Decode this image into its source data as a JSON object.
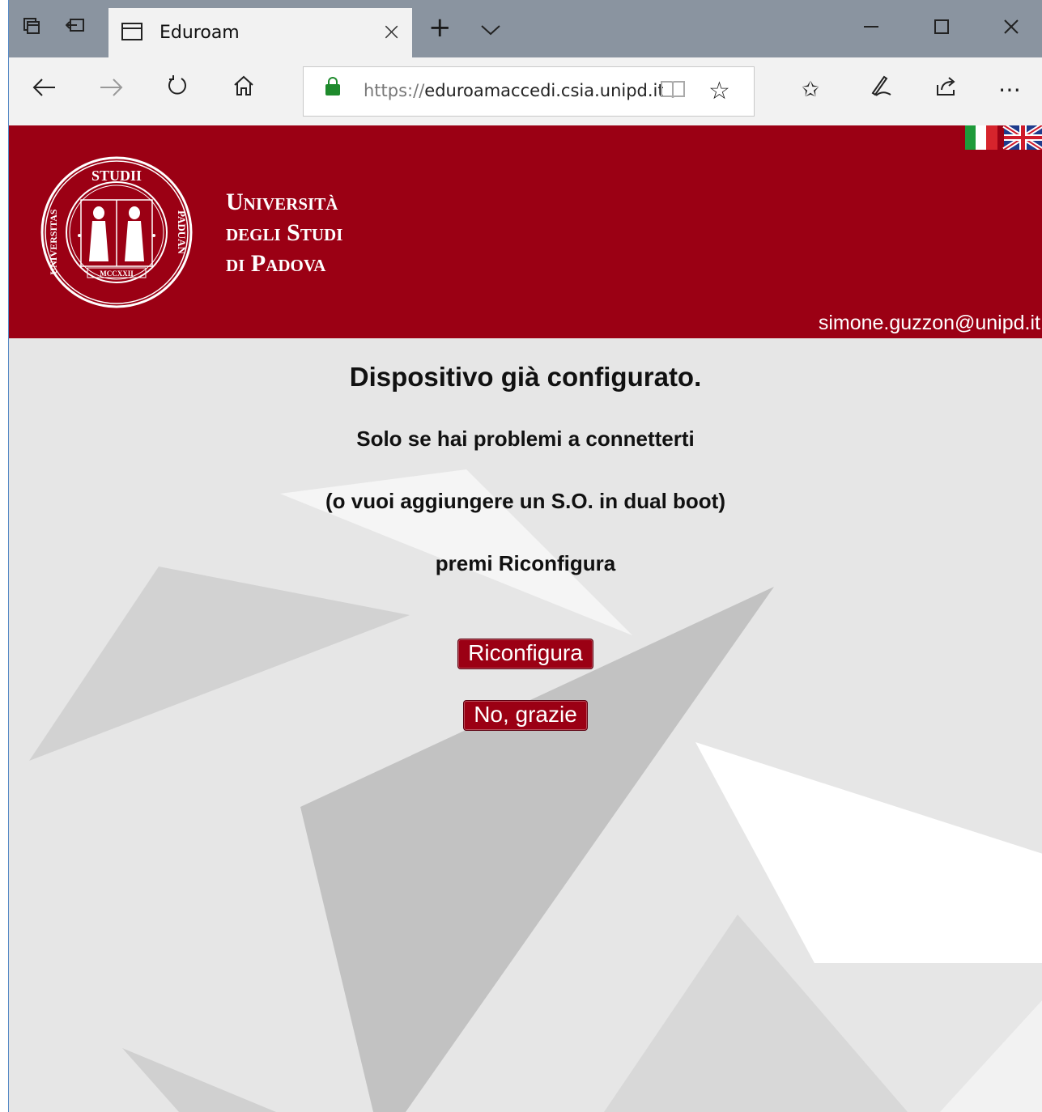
{
  "browser": {
    "tab_title": "Eduroam",
    "new_tab_label": "+",
    "tab_list_label": "∨",
    "url_scheme": "https://",
    "url_rest": "eduroamaccedi.csia.unipd.it",
    "icons": [
      "tab-preview-icon",
      "set-aside-icon",
      "back-icon",
      "forward-icon",
      "refresh-icon",
      "home-icon",
      "reading-view-icon",
      "favorite-star-icon",
      "favorites-hub-icon",
      "web-note-icon",
      "share-icon",
      "more-icon",
      "minimize-icon",
      "maximize-icon",
      "close-window-icon"
    ]
  },
  "header": {
    "university_line1": "Università",
    "university_line2": "degli Studi",
    "university_line3": "di Padova",
    "seal_text_top": "STUDII",
    "seal_text_left": "UNIVERSITAS",
    "seal_text_right": "PADUAN",
    "seal_date": "MCCXXII",
    "user_email": "simone.guzzon@unipd.it",
    "brand_color": "#9b0014"
  },
  "main": {
    "title": "Dispositivo già configurato.",
    "line1": "Solo se hai problemi a connetterti",
    "line2": "(o vuoi aggiungere un S.O. in dual boot)",
    "line3": "premi Riconfigura",
    "reconfigure_button": "Riconfigura",
    "no_thanks_button": "No, grazie"
  }
}
